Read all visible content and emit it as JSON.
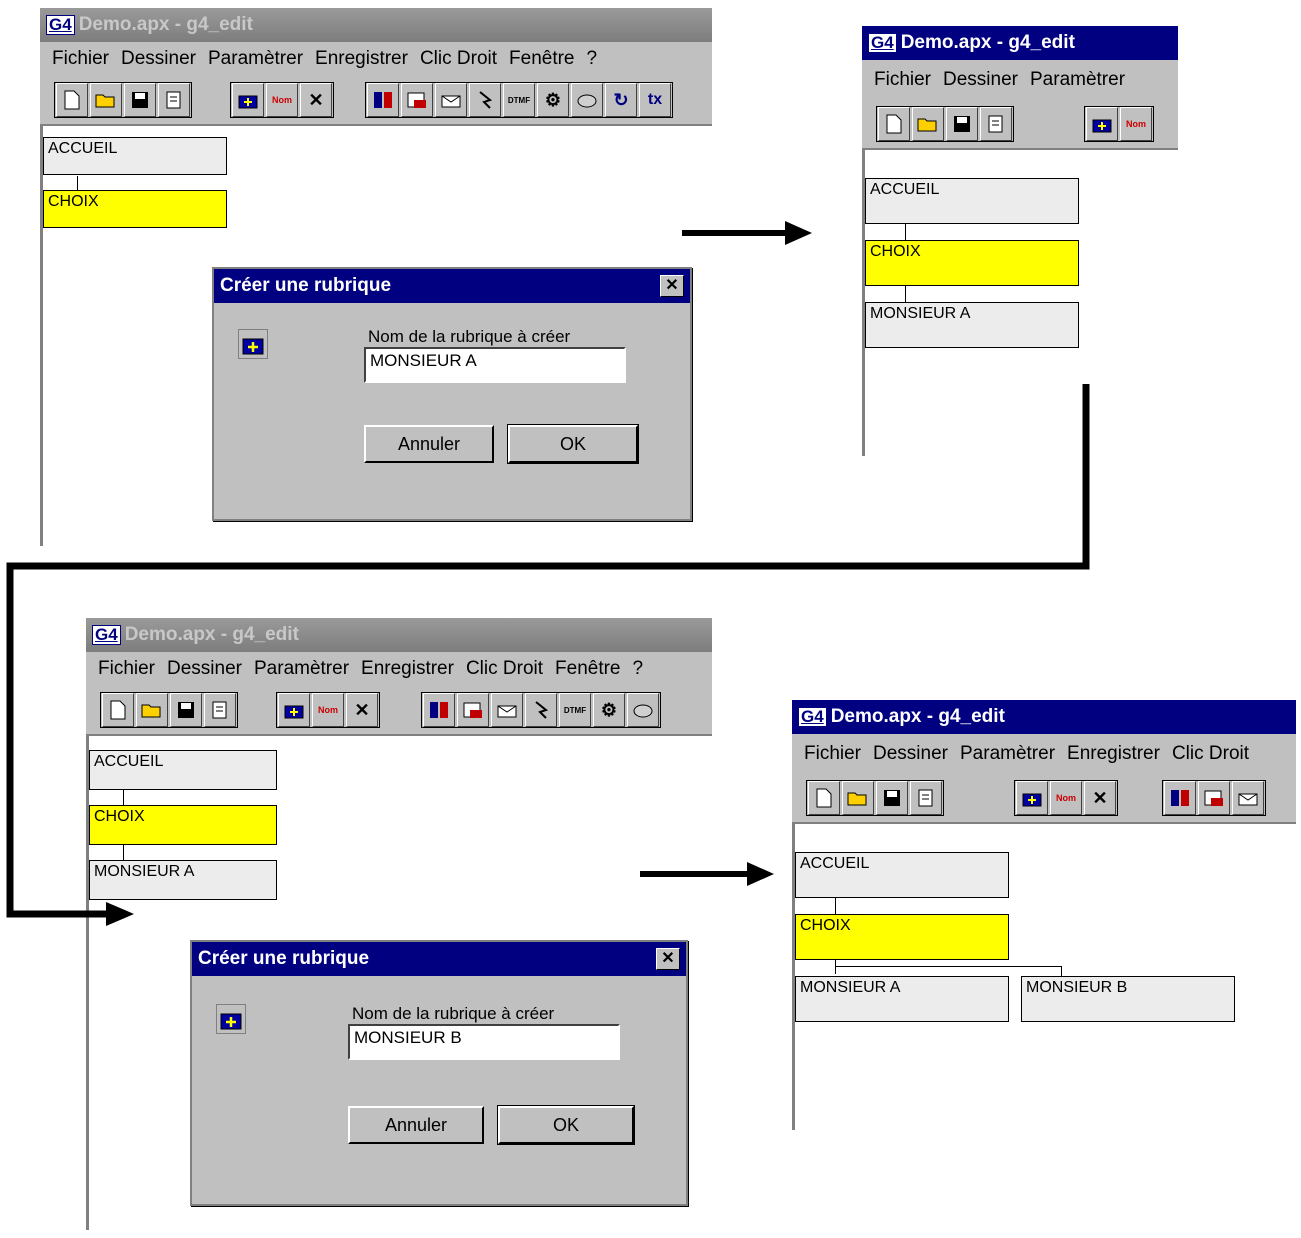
{
  "app": {
    "logo": "G4",
    "title": "Demo.apx - g4_edit"
  },
  "menu": [
    "Fichier",
    "Dessiner",
    "Paramètrer",
    "Enregistrer",
    "Clic Droit",
    "Fenêtre",
    "?"
  ],
  "toolbar": {
    "icons": [
      "new-file-icon",
      "open-folder-icon",
      "save-disk-icon",
      "properties-icon",
      "add-rubrique-icon",
      "rename-icon",
      "delete-x-icon",
      "record-icon",
      "phone-icon",
      "message-icon",
      "digits-icon",
      "dtmf-icon",
      "gears-icon",
      "fax-icon",
      "loop-icon",
      "text-icon"
    ],
    "dtmf_label": "DTMF",
    "rename_label": "Nom",
    "text_label": "tx"
  },
  "nodes": {
    "accueil": "ACCUEIL",
    "choix": "CHOIX",
    "monsieur_a": "MONSIEUR A",
    "monsieur_b": "MONSIEUR B"
  },
  "dialog": {
    "title": "Créer une rubrique",
    "close_label": "✕",
    "field_label": "Nom de la rubrique à créer",
    "value_step1": "MONSIEUR A",
    "value_step3": "MONSIEUR B",
    "cancel_label": "Annuler",
    "ok_label": "OK"
  },
  "colors": {
    "title_active": "#000080",
    "title_inactive": "#808080",
    "window_face": "#c0c0c0",
    "node_selected": "#ffff00",
    "node_default": "#ececec"
  }
}
